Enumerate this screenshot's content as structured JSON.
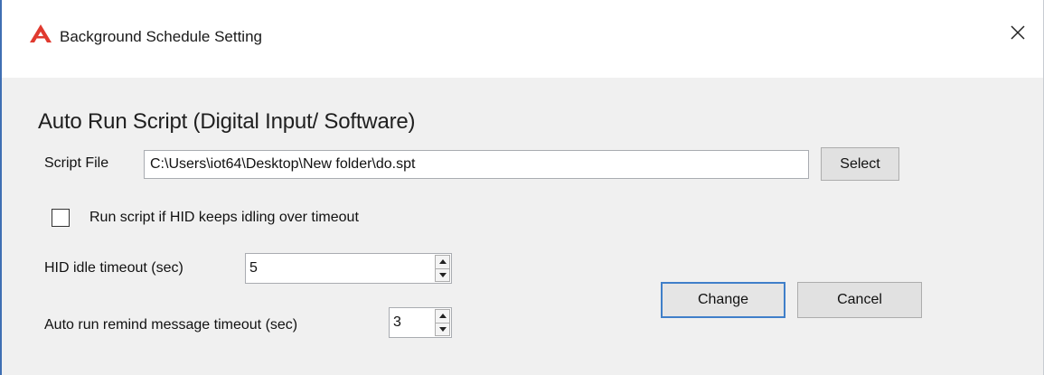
{
  "window": {
    "title": "Background Schedule Setting",
    "app_icon": "alpha-logo-icon",
    "close_icon": "close-icon",
    "accent_color": "#3f6fb3",
    "logo_color": "#e03a2f"
  },
  "section": {
    "heading": "Auto Run Script (Digital Input/ Software)"
  },
  "script_file": {
    "label": "Script File",
    "value": "C:\\Users\\iot64\\Desktop\\New folder\\do.spt",
    "select_label": "Select"
  },
  "run_if_idle": {
    "label": "Run script if HID keeps idling over timeout",
    "checked": false
  },
  "hid_idle_timeout": {
    "label": "HID idle timeout (sec)",
    "value": "5"
  },
  "remind_timeout": {
    "label": "Auto run remind message timeout (sec)",
    "value": "3"
  },
  "buttons": {
    "change": "Change",
    "cancel": "Cancel"
  }
}
